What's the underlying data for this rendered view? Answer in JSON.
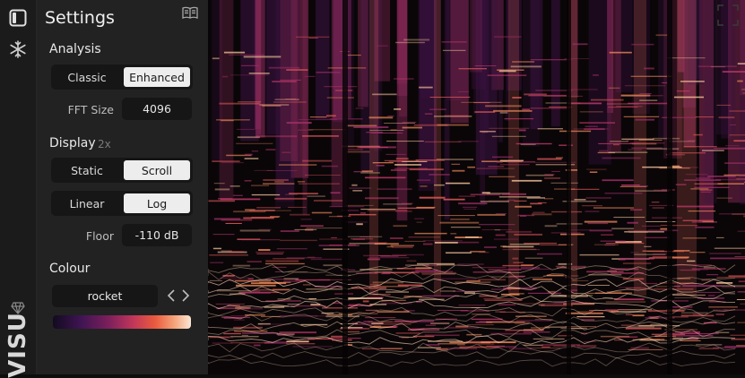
{
  "app": {
    "brand": "VISU"
  },
  "rail": {
    "icons": [
      "sidebar-toggle-icon",
      "snowflake-icon",
      "gem-icon"
    ]
  },
  "settings": {
    "title": "Settings",
    "analysis": {
      "title": "Analysis",
      "mode_options": [
        "Classic",
        "Enhanced"
      ],
      "mode_selected": "Enhanced",
      "fft_label": "FFT Size",
      "fft_value": "4096"
    },
    "display": {
      "title": "Display",
      "note": "2x",
      "scroll_options": [
        "Static",
        "Scroll"
      ],
      "scroll_selected": "Scroll",
      "scale_options": [
        "Linear",
        "Log"
      ],
      "scale_selected": "Log",
      "floor_label": "Floor",
      "floor_value": "-110 dB"
    },
    "colour": {
      "title": "Colour",
      "map": "rocket",
      "gradient": [
        "#120b1f",
        "#3e1452",
        "#7a1f5c",
        "#c0365a",
        "#ea5a3e",
        "#f4a47a",
        "#fae7d5"
      ]
    }
  },
  "spectrogram": {
    "colormap": "rocket",
    "background": "#0a0608"
  }
}
